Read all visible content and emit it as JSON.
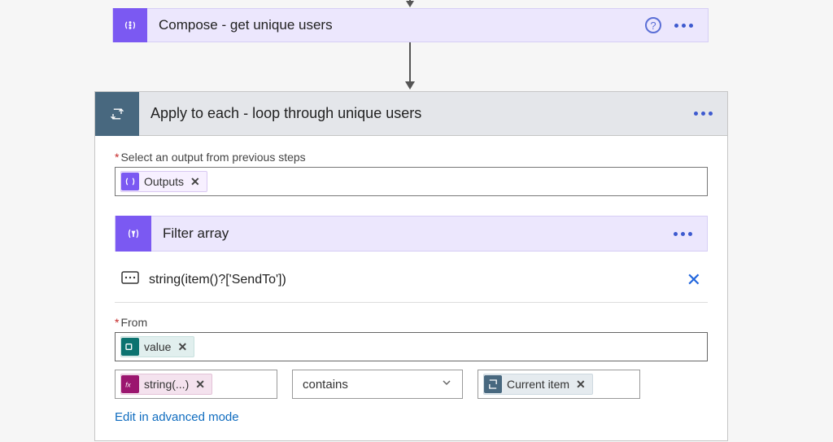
{
  "compose": {
    "title": "Compose - get unique users"
  },
  "apply": {
    "title": "Apply to each - loop through unique users",
    "select_label": "Select an output from previous steps",
    "token_outputs": "Outputs"
  },
  "filter": {
    "title": "Filter array",
    "expression": "string(item()?['SendTo'])",
    "from_label": "From",
    "token_value": "value",
    "cond_left": "string(...)",
    "cond_op": "contains",
    "cond_right": "Current item",
    "adv_link": "Edit in advanced mode"
  }
}
